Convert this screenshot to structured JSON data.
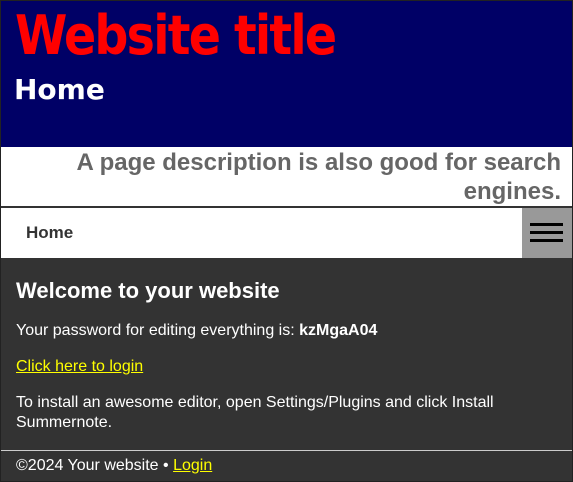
{
  "header": {
    "site_title": "Website title",
    "page_title": "Home"
  },
  "description": "A page description is also good for search engines.",
  "nav": {
    "home_label": "Home",
    "menu_icon": "hamburger-menu-icon"
  },
  "content": {
    "heading": "Welcome to your website",
    "password_label": "Your password for editing everything is: ",
    "password_value": "kzMgaA04",
    "login_link": "Click here to login",
    "install_text": "To install an awesome editor, open Settings/Plugins and click Install Summernote."
  },
  "footer": {
    "copyright": "©2024 Your website • ",
    "login_link": "Login"
  },
  "colors": {
    "header_bg": "#000066",
    "title_red": "#ff0000",
    "content_bg": "#333333",
    "link_yellow": "#ffff00",
    "description_gray": "#666666",
    "menu_toggle_bg": "#999999"
  }
}
